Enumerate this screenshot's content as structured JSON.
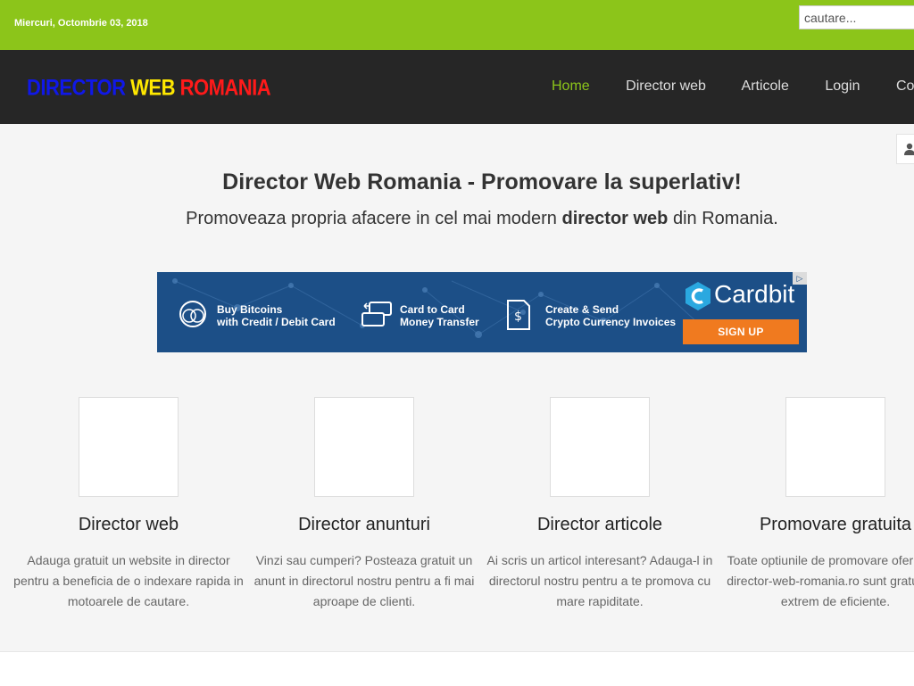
{
  "topbar": {
    "date": "Miercuri, Octombrie 03, 2018",
    "search_placeholder": "cautare..."
  },
  "logo": {
    "word1": "DIRECTOR",
    "word2": "WEB",
    "word3": "ROMANIA"
  },
  "menu": [
    {
      "label": "Home",
      "active": true
    },
    {
      "label": "Director web"
    },
    {
      "label": "Articole"
    },
    {
      "label": "Login"
    },
    {
      "label": "Contact"
    }
  ],
  "hero": {
    "title": "Director Web Romania - Promovare la superlativ!",
    "sub_before": "Promoveaza propria afacere in cel mai modern ",
    "sub_bold": "director web",
    "sub_after": " din Romania."
  },
  "banner": {
    "feature1_line1": "Buy Bitcoins",
    "feature1_line2": "with Credit / Debit Card",
    "feature2_line1": "Card to Card",
    "feature2_line2": "Money Transfer",
    "feature3_line1": "Create & Send",
    "feature3_line2": "Crypto Currency Invoices",
    "brand": "Cardbit",
    "signup": "SIGN UP"
  },
  "features": [
    {
      "title": "Director web",
      "text": "Adauga gratuit un website in director pentru a beneficia de o indexare rapida in motoarele de cautare."
    },
    {
      "title": "Director anunturi",
      "text": "Vinzi sau cumperi? Posteaza gratuit un anunt in directorul nostru pentru a fi mai aproape de clienti."
    },
    {
      "title": "Director articole",
      "text": "Ai scris un articol interesant? Adauga-l in directorul nostru pentru a te promova cu mare rapiditate."
    },
    {
      "title": "Promovare gratuita",
      "text": "Toate optiunile de promovare oferite de director-web-romania.ro sunt gratuite si extrem de eficiente."
    }
  ],
  "colors": {
    "accent_green": "#8cc51a",
    "nav_bg": "#262626",
    "banner_bg": "#1c4f87",
    "signup_orange": "#f07a1f"
  }
}
